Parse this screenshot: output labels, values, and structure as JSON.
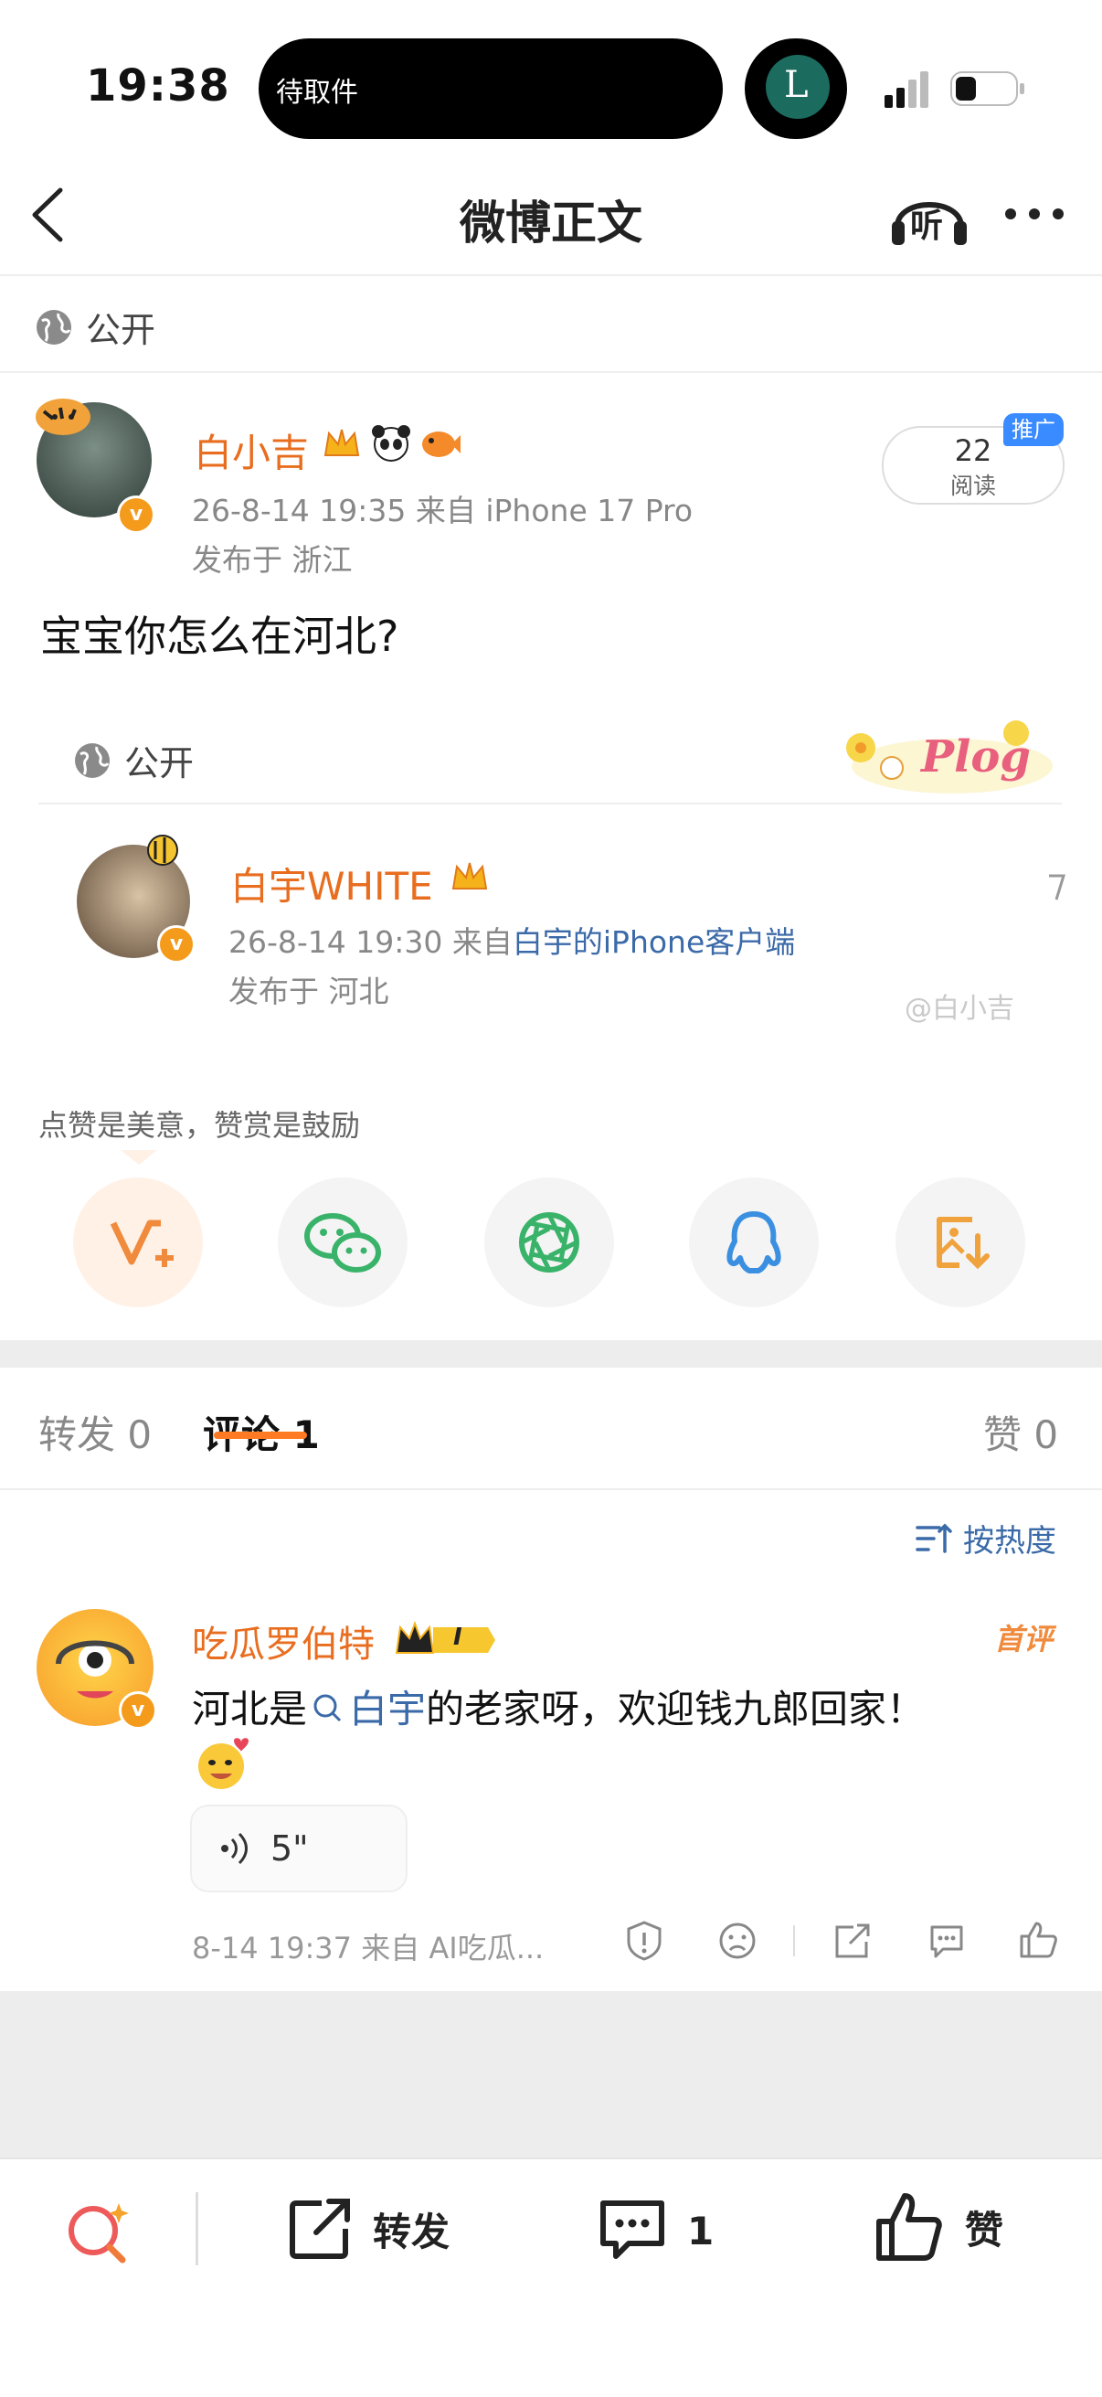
{
  "status_bar": {
    "time": "19:38",
    "island_text": "待取件",
    "island_app_letter": "L"
  },
  "nav": {
    "title": "微博正文",
    "listen_label": "听"
  },
  "visibility_label": "公开",
  "post": {
    "author": "白小吉",
    "meta_line": "26-8-14 19:35  来自 iPhone 17 Pro",
    "location": "发布于 浙江",
    "text": "宝宝你怎么在河北?",
    "read_count": "22",
    "read_label": "阅读",
    "promo_badge": "推广"
  },
  "retweet": {
    "visibility_label": "公开",
    "sticker_text": "Plog",
    "author": "白宇WHITE",
    "meta_time": "26-8-14 19:30  来自",
    "meta_source": "白宇的iPhone客户端",
    "location": "发布于 河北",
    "watermark": "@白小吉"
  },
  "reward_hint": "点赞是美意，赞赏是鼓励",
  "share_buttons": [
    "reward-icon",
    "wechat-icon",
    "moments-icon",
    "qq-icon",
    "save-image-icon"
  ],
  "tabs": {
    "repost": "转发 0",
    "comment": "评论 1",
    "like": "赞 0"
  },
  "sort_label": "按热度",
  "comment": {
    "author": "吃瓜罗伯特",
    "level_badge": "I",
    "first_badge": "首评",
    "text_before": "河北是",
    "text_link": "白宇",
    "text_after": "的老家呀，欢迎钱九郎回家！",
    "voice_duration": "5\"",
    "meta": "8-14 19:37  来自 AI吃瓜..."
  },
  "bottom_bar": {
    "repost_label": "转发",
    "comment_count": "1",
    "like_label": "赞"
  },
  "colors": {
    "accent_orange": "#e86d1f",
    "link_blue": "#3b6aa8",
    "gray_band": "#ededed"
  }
}
